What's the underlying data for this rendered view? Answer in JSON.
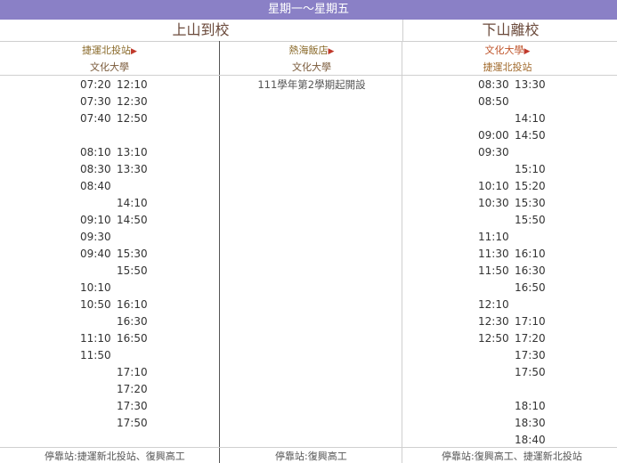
{
  "banner": "星期一～星期五",
  "headers": {
    "up": "上山到校",
    "down": "下山離校"
  },
  "routes": {
    "col1": {
      "from": "捷運北投站",
      "arrow": "▶",
      "to": "文化大學"
    },
    "col2": {
      "from": "熱海飯店",
      "arrow": "▶",
      "to": "文化大學"
    },
    "col3": {
      "from": "文化大學",
      "arrow": "▶",
      "to": "捷運北投站"
    }
  },
  "col2_note": "111學年第2學期起開設",
  "up_rows": [
    [
      "07:20",
      "12:10"
    ],
    [
      "07:30",
      "12:30"
    ],
    [
      "07:40",
      "12:50"
    ],
    [
      "",
      ""
    ],
    [
      "08:10",
      "13:10"
    ],
    [
      "08:30",
      "13:30"
    ],
    [
      "08:40",
      ""
    ],
    [
      "",
      "14:10"
    ],
    [
      "09:10",
      "14:50"
    ],
    [
      "09:30",
      ""
    ],
    [
      "09:40",
      "15:30"
    ],
    [
      "",
      "15:50"
    ],
    [
      "10:10",
      ""
    ],
    [
      "10:50",
      "16:10"
    ],
    [
      "",
      "16:30"
    ],
    [
      "11:10",
      "16:50"
    ],
    [
      "11:50",
      ""
    ],
    [
      "",
      "17:10"
    ],
    [
      "",
      "17:20"
    ],
    [
      "",
      "17:30"
    ],
    [
      "",
      "17:50"
    ]
  ],
  "down_rows": [
    [
      "08:30",
      "13:30"
    ],
    [
      "08:50",
      ""
    ],
    [
      "",
      "14:10"
    ],
    [
      "09:00",
      "14:50"
    ],
    [
      "09:30",
      ""
    ],
    [
      "",
      "15:10"
    ],
    [
      "10:10",
      "15:20"
    ],
    [
      "10:30",
      "15:30"
    ],
    [
      "",
      "15:50"
    ],
    [
      "11:10",
      ""
    ],
    [
      "11:30",
      "16:10"
    ],
    [
      "11:50",
      "16:30"
    ],
    [
      "",
      "16:50"
    ],
    [
      "12:10",
      ""
    ],
    [
      "12:30",
      "17:10"
    ],
    [
      "12:50",
      "17:20"
    ],
    [
      "",
      "17:30"
    ],
    [
      "",
      "17:50"
    ],
    [
      "",
      ""
    ],
    [
      "",
      "18:10"
    ],
    [
      "",
      "18:30"
    ],
    [
      "",
      "18:40"
    ]
  ],
  "footer": {
    "col1": "停靠站:捷運新北投站、復興高工",
    "col2": "停靠站:復興高工",
    "col3": "停靠站:復興高工、捷運新北投站"
  }
}
